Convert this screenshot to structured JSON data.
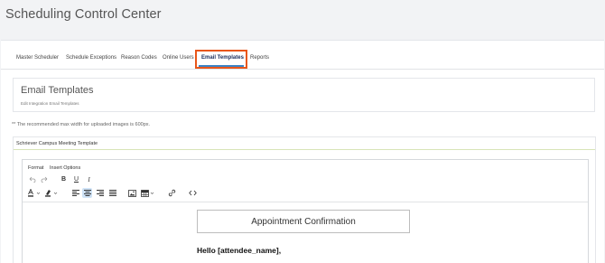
{
  "app": {
    "title": "Scheduling Control Center"
  },
  "tabs": [
    {
      "label": "Master Scheduler"
    },
    {
      "label": "Schedule Exceptions"
    },
    {
      "label": "Reason Codes"
    },
    {
      "label": "Online Users"
    },
    {
      "label": "Email Templates",
      "active": true
    },
    {
      "label": "Reports"
    }
  ],
  "panel": {
    "title": "Email Templates",
    "subtitle": "Edit Integration Email Templates"
  },
  "note": "** The recommended max width for uploaded images is 600px.",
  "template": {
    "title": "Schriever Campus Meeting Template",
    "menubar": [
      "Format",
      "Insert Options"
    ],
    "toolbar": [
      "undo-icon",
      "redo-icon",
      "bold-icon",
      "underline-icon",
      "italic-icon",
      "text-color-icon",
      "highlight-color-icon",
      "align-left-icon",
      "align-center-icon",
      "align-right-icon",
      "align-justify-icon",
      "image-icon",
      "table-icon",
      "link-icon",
      "source-code-icon"
    ],
    "active_tool": "align-center-icon",
    "content": {
      "heading": "Appointment Confirmation",
      "greeting": "Hello [attendee_name],"
    }
  },
  "colors": {
    "active_tab_underline": "#3b82c4",
    "highlight_box": "#e8561a",
    "active_tool_bg": "#cfe3f7"
  }
}
